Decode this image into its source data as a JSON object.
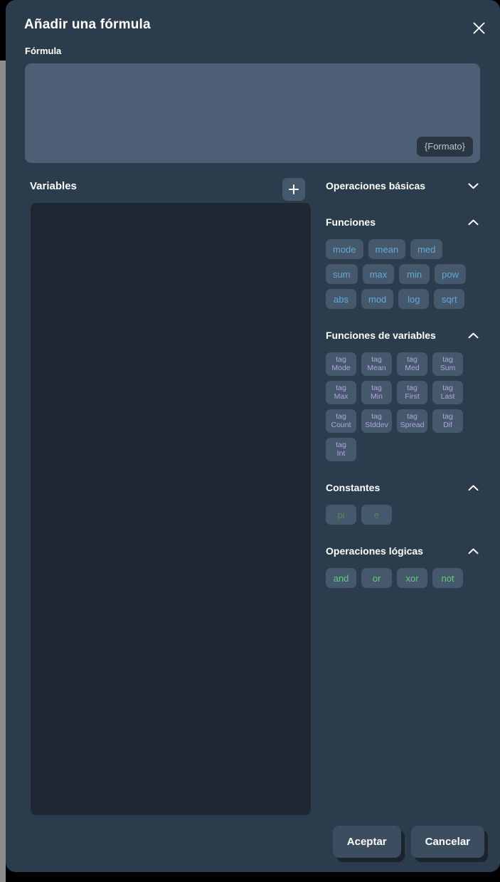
{
  "modal": {
    "title": "Añadir una fórmula",
    "close_icon": "close-icon"
  },
  "formula": {
    "label": "Fórmula",
    "value": "",
    "placeholder": "",
    "format_chip": "{Formato}"
  },
  "variables": {
    "title": "Variables",
    "add_icon": "plus-icon",
    "items": []
  },
  "right_panel": {
    "sections": [
      {
        "title": "Operaciones básicas",
        "expanded": false,
        "chevron": "chevron-down-icon",
        "items": []
      },
      {
        "title": "Funciones",
        "expanded": true,
        "chevron": "chevron-up-icon",
        "items": [
          "mode",
          "mean",
          "med",
          "sum",
          "max",
          "min",
          "pow",
          "abs",
          "mod",
          "log",
          "sqrt"
        ]
      },
      {
        "title": "Funciones de variables",
        "expanded": true,
        "chevron": "chevron-up-icon",
        "items": [
          {
            "line1": "tag",
            "line2": "Mode"
          },
          {
            "line1": "tag",
            "line2": "Mean"
          },
          {
            "line1": "tag",
            "line2": "Med"
          },
          {
            "line1": "tag",
            "line2": "Sum"
          },
          {
            "line1": "tag",
            "line2": "Max"
          },
          {
            "line1": "tag",
            "line2": "Min"
          },
          {
            "line1": "tag",
            "line2": "First"
          },
          {
            "line1": "tag",
            "line2": "Last"
          },
          {
            "line1": "tag",
            "line2": "Count"
          },
          {
            "line1": "tag",
            "line2": "Stddev"
          },
          {
            "line1": "tag",
            "line2": "Spread"
          },
          {
            "line1": "tag",
            "line2": "Dif"
          },
          {
            "line1": "tag",
            "line2": "Int"
          }
        ]
      },
      {
        "title": "Constantes",
        "expanded": true,
        "chevron": "chevron-up-icon",
        "items": [
          "pi",
          "e"
        ]
      },
      {
        "title": "Operaciones lógicas",
        "expanded": true,
        "chevron": "chevron-up-icon",
        "items": [
          "and",
          "or",
          "xor",
          "not"
        ]
      }
    ]
  },
  "footer": {
    "accept_label": "Aceptar",
    "cancel_label": "Cancelar"
  },
  "colors": {
    "modal_bg": "#2b3c4c",
    "formula_bg": "#4d5f74",
    "variables_list_bg": "#1f2733",
    "chip_bg": "#46586c",
    "function_text": "#61a8d8",
    "tag_text": "#b3a6e0",
    "constant_text": "#4f8c58",
    "logic_text": "#61cc7a",
    "button_bg": "#3c4d5f",
    "button_shadow": "#1b232d"
  }
}
